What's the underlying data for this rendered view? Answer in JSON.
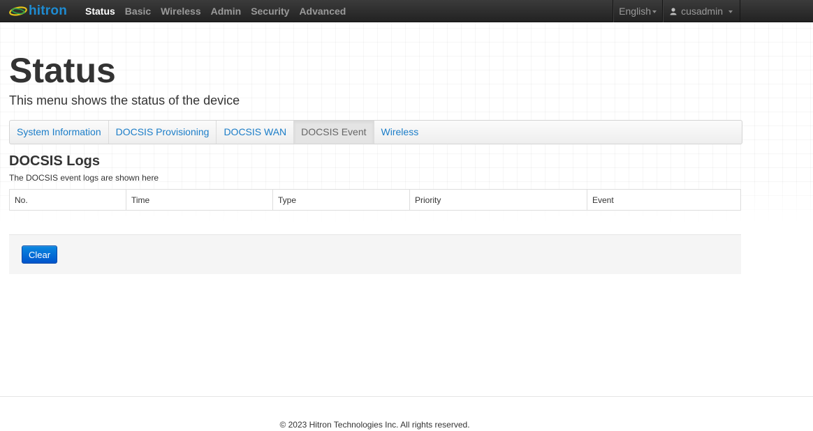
{
  "brand": {
    "logo_text": "hitron",
    "accent_color": "#1e8bd1"
  },
  "nav": {
    "items": [
      {
        "label": "Status",
        "active": true
      },
      {
        "label": "Basic",
        "active": false
      },
      {
        "label": "Wireless",
        "active": false
      },
      {
        "label": "Admin",
        "active": false
      },
      {
        "label": "Security",
        "active": false
      },
      {
        "label": "Advanced",
        "active": false
      }
    ],
    "language": "English",
    "user": "cusadmin"
  },
  "page": {
    "title": "Status",
    "subtitle": "This menu shows the status of the device"
  },
  "tabs": [
    {
      "label": "System Information",
      "active": false
    },
    {
      "label": "DOCSIS Provisioning",
      "active": false
    },
    {
      "label": "DOCSIS WAN",
      "active": false
    },
    {
      "label": "DOCSIS Event",
      "active": true
    },
    {
      "label": "Wireless",
      "active": false
    }
  ],
  "section": {
    "title": "DOCSIS Logs",
    "description": "The DOCSIS event logs are shown here"
  },
  "table": {
    "columns": [
      "No.",
      "Time",
      "Type",
      "Priority",
      "Event"
    ],
    "rows": []
  },
  "actions": {
    "clear_label": "Clear",
    "button_color": "#0066d6"
  },
  "footer": {
    "copyright": "© 2023 Hitron Technologies Inc. All rights reserved."
  }
}
